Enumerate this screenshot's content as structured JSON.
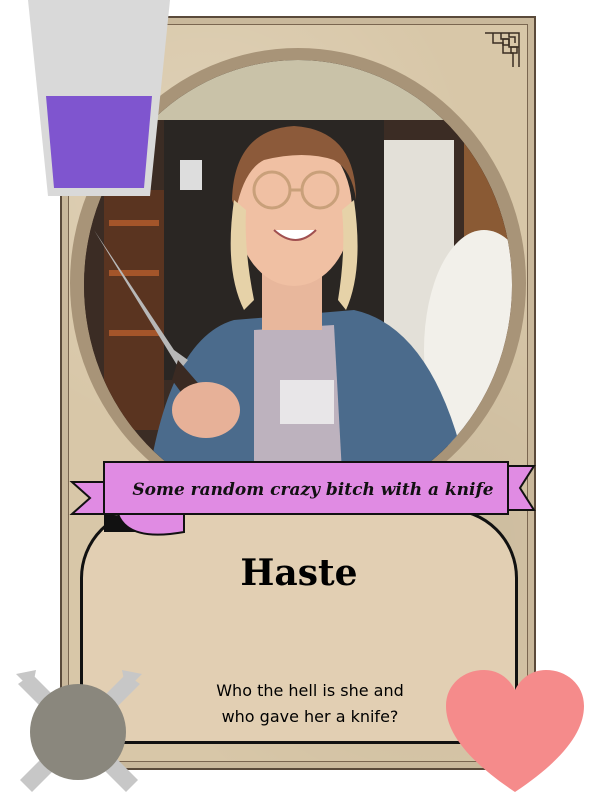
{
  "card": {
    "name": "Haste",
    "flavor_title": "Some random crazy bitch with a knife",
    "description_line1": "Who the hell is she and",
    "description_line2": "who gave her a knife?"
  },
  "icons": {
    "mana": "mana-glass-icon",
    "attack": "crossed-swords-shield-icon",
    "health": "heart-icon"
  },
  "colors": {
    "frame": "#c9b89b",
    "panel": "#e2cfb3",
    "banner": "#e08be3",
    "mana_fill": "#7f55cf",
    "health": "#f58b8b",
    "attack": "#8a877d"
  }
}
